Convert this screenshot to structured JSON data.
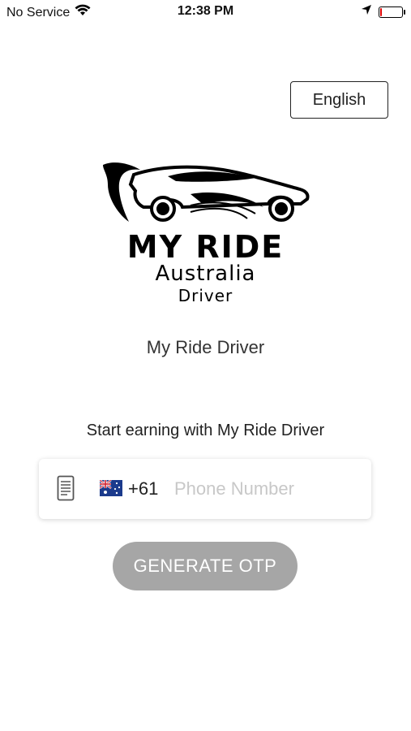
{
  "status_bar": {
    "carrier": "No Service",
    "time": "12:38 PM"
  },
  "language_button": {
    "label": "English"
  },
  "logo": {
    "title": "MY RIDE",
    "subtitle": "Australia",
    "subtitle2": "Driver"
  },
  "app_name": "My Ride Driver",
  "tagline": "Start earning with My Ride Driver",
  "phone": {
    "country_code": "+61",
    "placeholder": "Phone Number",
    "value": ""
  },
  "otp_button": {
    "label": "GENERATE OTP"
  },
  "colors": {
    "button_disabled": "#a6a6a6",
    "battery_low": "#dd0000"
  }
}
